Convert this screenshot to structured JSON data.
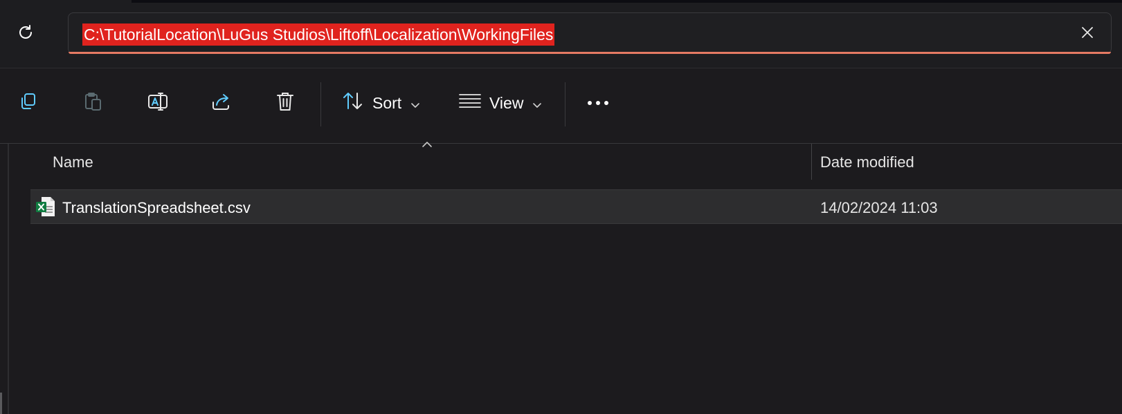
{
  "address_bar": {
    "path": "C:\\TutorialLocation\\LuGus Studios\\Liftoff\\Localization\\WorkingFiles"
  },
  "toolbar": {
    "icons": [
      "refresh-icon",
      "copy-icon",
      "paste-icon",
      "rename-icon",
      "share-icon",
      "delete-icon",
      "sort-icon",
      "view-icon",
      "more-icon",
      "close-icon"
    ],
    "sort_label": "Sort",
    "view_label": "View",
    "more_label": "•••"
  },
  "file_list": {
    "columns": {
      "name": "Name",
      "date_modified": "Date modified"
    },
    "sort_indicator": "ascending",
    "rows": [
      {
        "name": "TranslationSpreadsheet.csv",
        "date_modified": "14/02/2024 11:03",
        "icon": "excel-csv-icon"
      }
    ]
  },
  "colors": {
    "background": "#1c1b1e",
    "path_highlight": "#e0231e",
    "address_underline": "#e57a63",
    "accent_icon": "#60cdff",
    "excel_green": "#107c41"
  }
}
